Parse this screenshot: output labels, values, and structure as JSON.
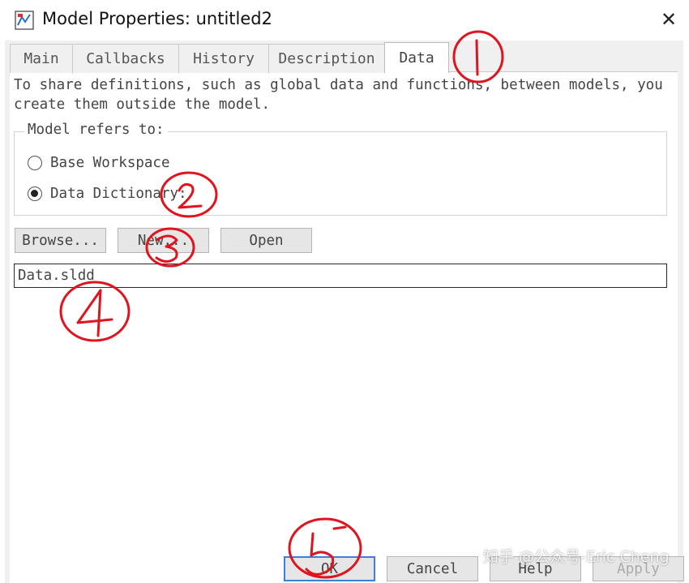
{
  "window": {
    "title": "Model Properties: untitled2",
    "close_glyph": "✕"
  },
  "tabs": [
    {
      "label": "Main",
      "active": false
    },
    {
      "label": "Callbacks",
      "active": false
    },
    {
      "label": "History",
      "active": false
    },
    {
      "label": "Description",
      "active": false
    },
    {
      "label": "Data",
      "active": true
    }
  ],
  "data_tab": {
    "info_line1": "To share definitions, such as global data and functions, between models, you",
    "info_line2": "create them outside the model.",
    "group_label": "Model refers to:",
    "options": [
      {
        "label": "Base Workspace",
        "selected": false
      },
      {
        "label": "Data Dictionary:",
        "selected": true
      }
    ],
    "buttons": {
      "browse": "Browse...",
      "new": "New...",
      "open": "Open"
    },
    "dictionary_file": "Data.sldd"
  },
  "footer": {
    "ok": "OK",
    "cancel": "Cancel",
    "help": "Help",
    "apply": "Apply"
  },
  "annotations": {
    "color": "#e0141e",
    "marks": [
      "1",
      "2",
      "3",
      "4",
      "5"
    ]
  },
  "watermark": "知乎 @公众号-Eric Cheng"
}
